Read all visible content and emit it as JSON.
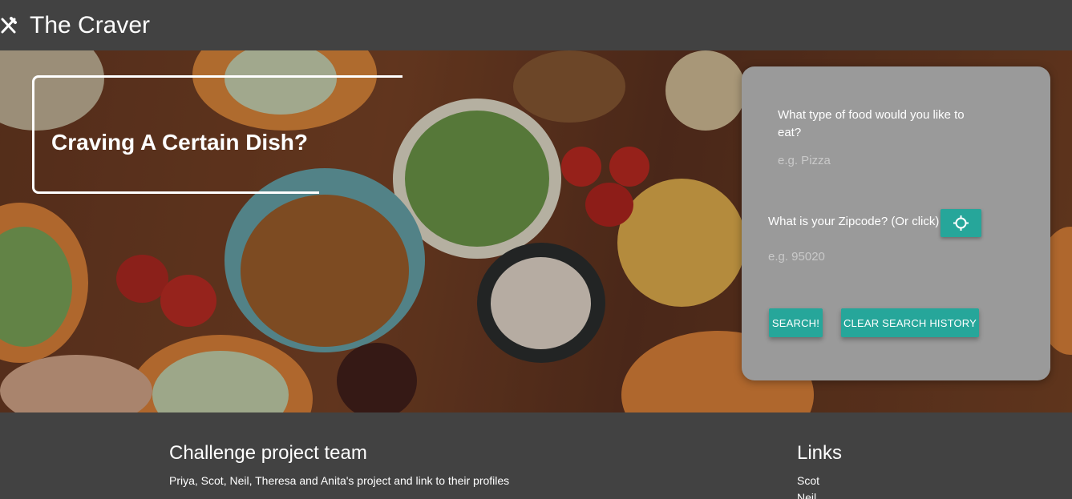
{
  "header": {
    "title": "The Craver",
    "logo_icon": "fork-knife-icon"
  },
  "hero": {
    "headline": "Craving A Certain Dish?"
  },
  "search_card": {
    "food_question": "What type of food would you like to eat?",
    "food_placeholder": "e.g. Pizza",
    "zip_question": "What is your Zipcode? (Or click)",
    "zip_placeholder": "e.g. 95020",
    "locate_icon": "crosshair-icon",
    "search_label": "SEARCH!",
    "clear_label": "CLEAR SEARCH HISTORY"
  },
  "footer": {
    "team_title": "Challenge project team",
    "team_description": "Priya, Scot, Neil, Theresa and Anita's project and link to their profiles",
    "links_title": "Links",
    "links": [
      "Scot",
      "Neil"
    ]
  },
  "colors": {
    "bar": "#424242",
    "accent": "#26a69a",
    "card": "#9a9a9a"
  }
}
